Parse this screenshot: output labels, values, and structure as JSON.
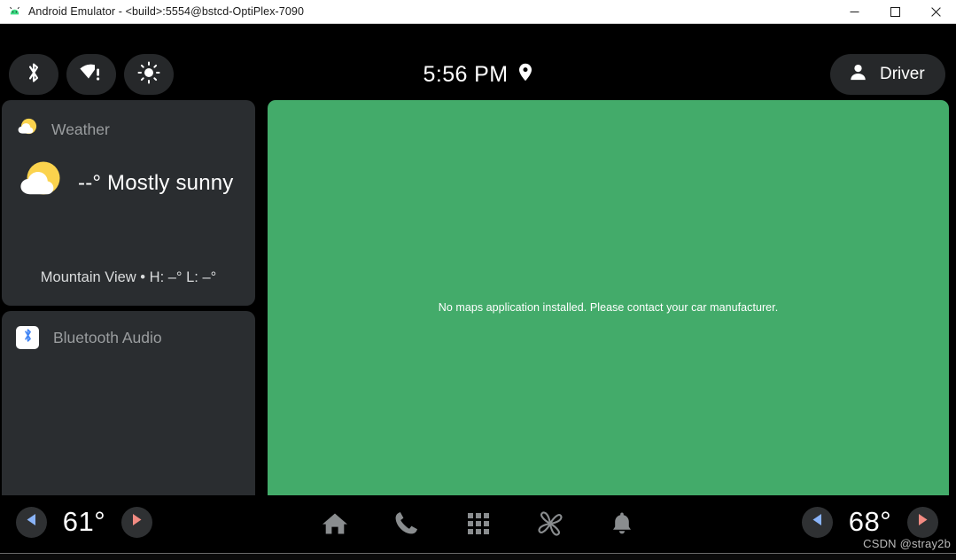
{
  "window": {
    "title": "Android Emulator - <build>:5554@bstcd-OptiPlex-7090",
    "app_icon": "android-emulator-icon",
    "minimize_label": "Minimize",
    "maximize_label": "Maximize",
    "close_label": "Close"
  },
  "status_bar": {
    "quick_toggles": [
      {
        "name": "bluetooth-toggle",
        "icon": "bluetooth-icon"
      },
      {
        "name": "wifi-toggle",
        "icon": "wifi-warning-icon"
      },
      {
        "name": "brightness-toggle",
        "icon": "brightness-sun-icon"
      }
    ],
    "clock": "5:56 PM",
    "location_icon": "location-pin-icon",
    "user": {
      "avatar_icon": "person-icon",
      "label": "Driver"
    }
  },
  "sidebar": {
    "weather_card": {
      "header_icon": "sun-cloud-icon",
      "header_label": "Weather",
      "condition_icon": "sun-cloud-icon",
      "condition": "--° Mostly sunny",
      "footer": "Mountain View • H: –° L: –°"
    },
    "media_card": {
      "badge_icon": "bluetooth-icon",
      "label": "Bluetooth Audio"
    }
  },
  "map_panel": {
    "color": "#43ab6a",
    "message": "No maps application installed. Please contact your car manufacturer."
  },
  "nav_bar": {
    "driver_climate": {
      "name": "driver-temperature",
      "decrease_icon": "triangle-left-icon",
      "value": "61°",
      "increase_icon": "triangle-right-icon"
    },
    "passenger_climate": {
      "name": "passenger-temperature",
      "decrease_icon": "triangle-left-icon",
      "value": "68°",
      "increase_icon": "triangle-right-icon"
    },
    "items": [
      {
        "name": "nav-home",
        "icon": "home-icon",
        "label": "Home"
      },
      {
        "name": "nav-dialer",
        "icon": "phone-icon",
        "label": "Phone"
      },
      {
        "name": "nav-apps",
        "icon": "grid-apps-icon",
        "label": "Apps"
      },
      {
        "name": "nav-climate",
        "icon": "fan-icon",
        "label": "Climate"
      },
      {
        "name": "nav-notifications",
        "icon": "bell-icon",
        "label": "Notifications"
      }
    ]
  },
  "watermark": "CSDN @stray2b",
  "colors": {
    "accent_green": "#43ab6a",
    "card_bg": "#2a2d30",
    "pill_bg": "#26282a",
    "cool_arrow": "#8ab4f8",
    "warm_arrow": "#f28b82",
    "sun_yellow": "#fbd34d",
    "nav_icon": "#8a8d8f"
  }
}
